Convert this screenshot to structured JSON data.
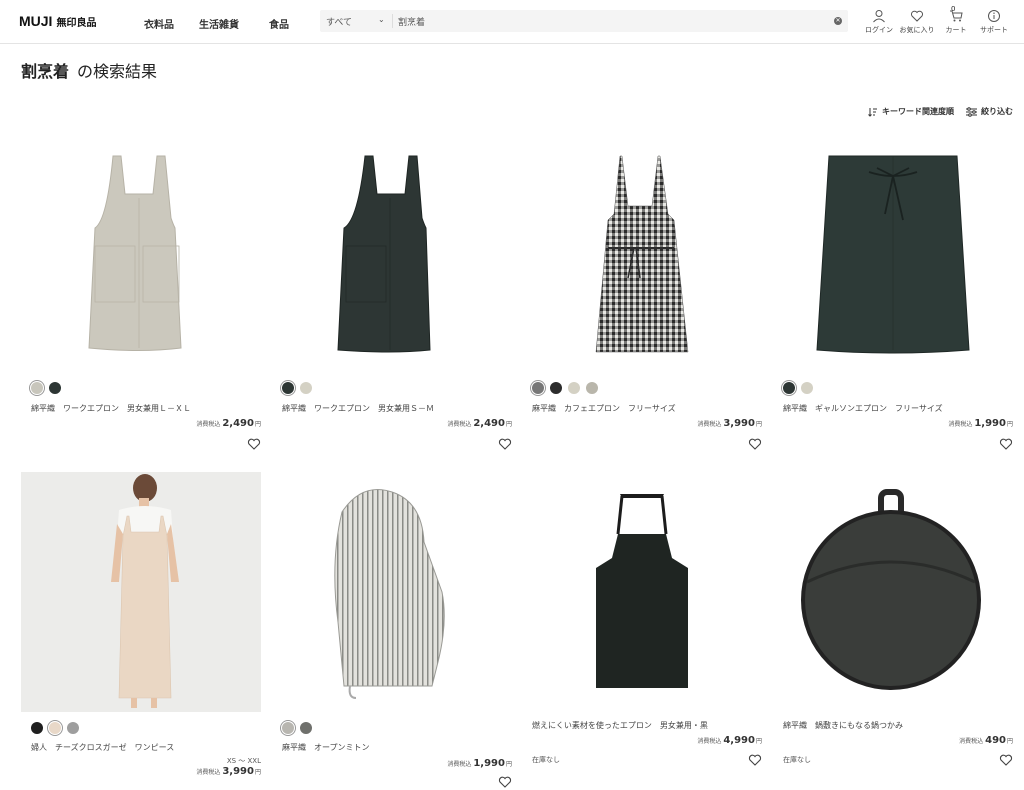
{
  "header": {
    "logo_en": "MUJI",
    "logo_jp": "無印良品",
    "nav": [
      "衣料品",
      "生活雑貨",
      "食品"
    ],
    "search": {
      "category": "すべて",
      "value": "割烹着"
    },
    "icons": [
      {
        "name": "user-icon",
        "label": "ログイン"
      },
      {
        "name": "heart-icon",
        "label": "お気に入り"
      },
      {
        "name": "cart-icon",
        "label": "カート",
        "badge": "0"
      },
      {
        "name": "info-icon",
        "label": "サポート"
      }
    ]
  },
  "title": {
    "keyword": "割烹着",
    "suffix": "の検索結果"
  },
  "sortbar": {
    "sort_label": "キーワード関連度順",
    "filter_label": "絞り込む"
  },
  "products": [
    {
      "name": "綿平織　ワークエプロン　男女兼用Ｌ－ＸＬ",
      "tax_label": "消費税込",
      "price": "2,490",
      "currency": "円",
      "swatches": [
        "#c8c6bc",
        "#2d3634"
      ],
      "image": "apron-beige"
    },
    {
      "name": "綿平織　ワークエプロン　男女兼用Ｓ－Ｍ",
      "tax_label": "消費税込",
      "price": "2,490",
      "currency": "円",
      "swatches": [
        "#2d3634",
        "#d4d1c4"
      ],
      "image": "apron-dark"
    },
    {
      "name": "麻平織　カフェエプロン　フリーサイズ",
      "tax_label": "消費税込",
      "price": "3,990",
      "currency": "円",
      "swatches": [
        "#777777",
        "#2c2c2c",
        "#d4d1c4",
        "#b9b6ab"
      ],
      "image": "apron-gingham"
    },
    {
      "name": "綿平織　ギャルソンエプロン　フリーサイズ",
      "tax_label": "消費税込",
      "price": "1,990",
      "currency": "円",
      "swatches": [
        "#2d3634",
        "#d4d1c4"
      ],
      "image": "apron-garcon"
    },
    {
      "name": "婦人　チーズクロスガーゼ　ワンピース",
      "size": "XS ～ XXL",
      "tax_label": "消費税込",
      "price": "3,990",
      "currency": "円",
      "swatches": [
        "#1f1f1f",
        "#e8d8c8",
        "#9e9e9e"
      ],
      "image": "dress-model"
    },
    {
      "name": "麻平織　オープンミトン",
      "tax_label": "消費税込",
      "price": "1,990",
      "currency": "円",
      "swatches": [
        "#b8b6b0",
        "#6f706c"
      ],
      "image": "mitten"
    },
    {
      "name": "燃えにくい素材を使ったエプロン　男女兼用・黒",
      "tax_label": "消費税込",
      "price": "4,990",
      "currency": "円",
      "stock": "在庫なし",
      "swatches": [],
      "image": "apron-black"
    },
    {
      "name": "綿平織　鍋敷きにもなる鍋つかみ",
      "tax_label": "消費税込",
      "price": "490",
      "currency": "円",
      "stock": "在庫なし",
      "swatches": [],
      "image": "potholder"
    }
  ]
}
